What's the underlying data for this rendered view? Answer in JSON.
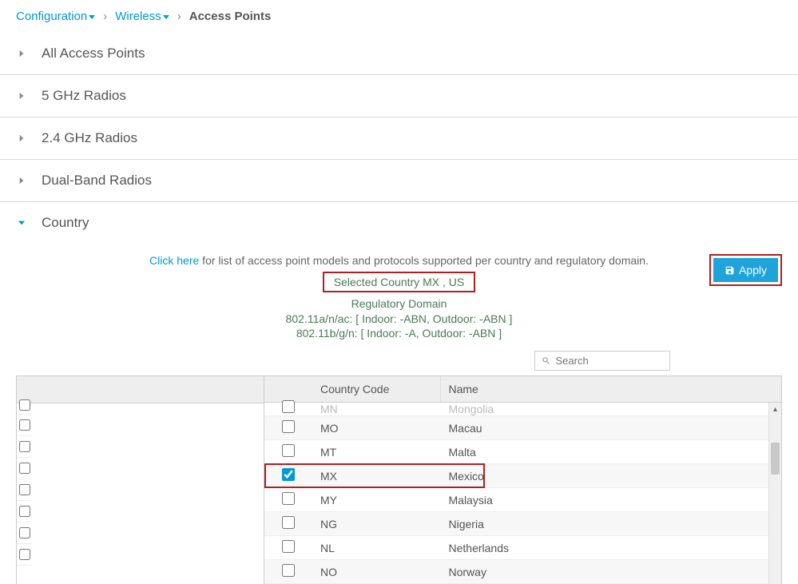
{
  "breadcrumb": {
    "config": "Configuration",
    "wireless": "Wireless",
    "current": "Access Points"
  },
  "sections": {
    "all": "All Access Points",
    "ghz5": "5 GHz Radios",
    "ghz24": "2.4 GHz Radios",
    "dual": "Dual-Band Radios",
    "country": "Country"
  },
  "info": {
    "click_here": "Click here",
    "click_rest": " for list of access point models and protocols supported per country and regulatory domain.",
    "selected_label": "Selected Country ",
    "selected_value": "MX , US",
    "reg_title": "Regulatory Domain",
    "reg_line1": "802.11a/n/ac: [ Indoor: -ABN, Outdoor: -ABN ]",
    "reg_line2": "802.11b/g/n: [ Indoor: -A, Outdoor: -ABN ]"
  },
  "apply_label": "Apply",
  "search_placeholder": "Search",
  "table": {
    "headers": {
      "code": "Country Code",
      "name": "Name"
    },
    "rows": [
      {
        "code": "MN",
        "name": "Mongolia",
        "checked": false,
        "cut": true
      },
      {
        "code": "MO",
        "name": "Macau",
        "checked": false
      },
      {
        "code": "MT",
        "name": "Malta",
        "checked": false
      },
      {
        "code": "MX",
        "name": "Mexico",
        "checked": true,
        "highlight": true
      },
      {
        "code": "MY",
        "name": "Malaysia",
        "checked": false
      },
      {
        "code": "NG",
        "name": "Nigeria",
        "checked": false
      },
      {
        "code": "NL",
        "name": "Netherlands",
        "checked": false
      },
      {
        "code": "NO",
        "name": "Norway",
        "checked": false
      }
    ]
  }
}
